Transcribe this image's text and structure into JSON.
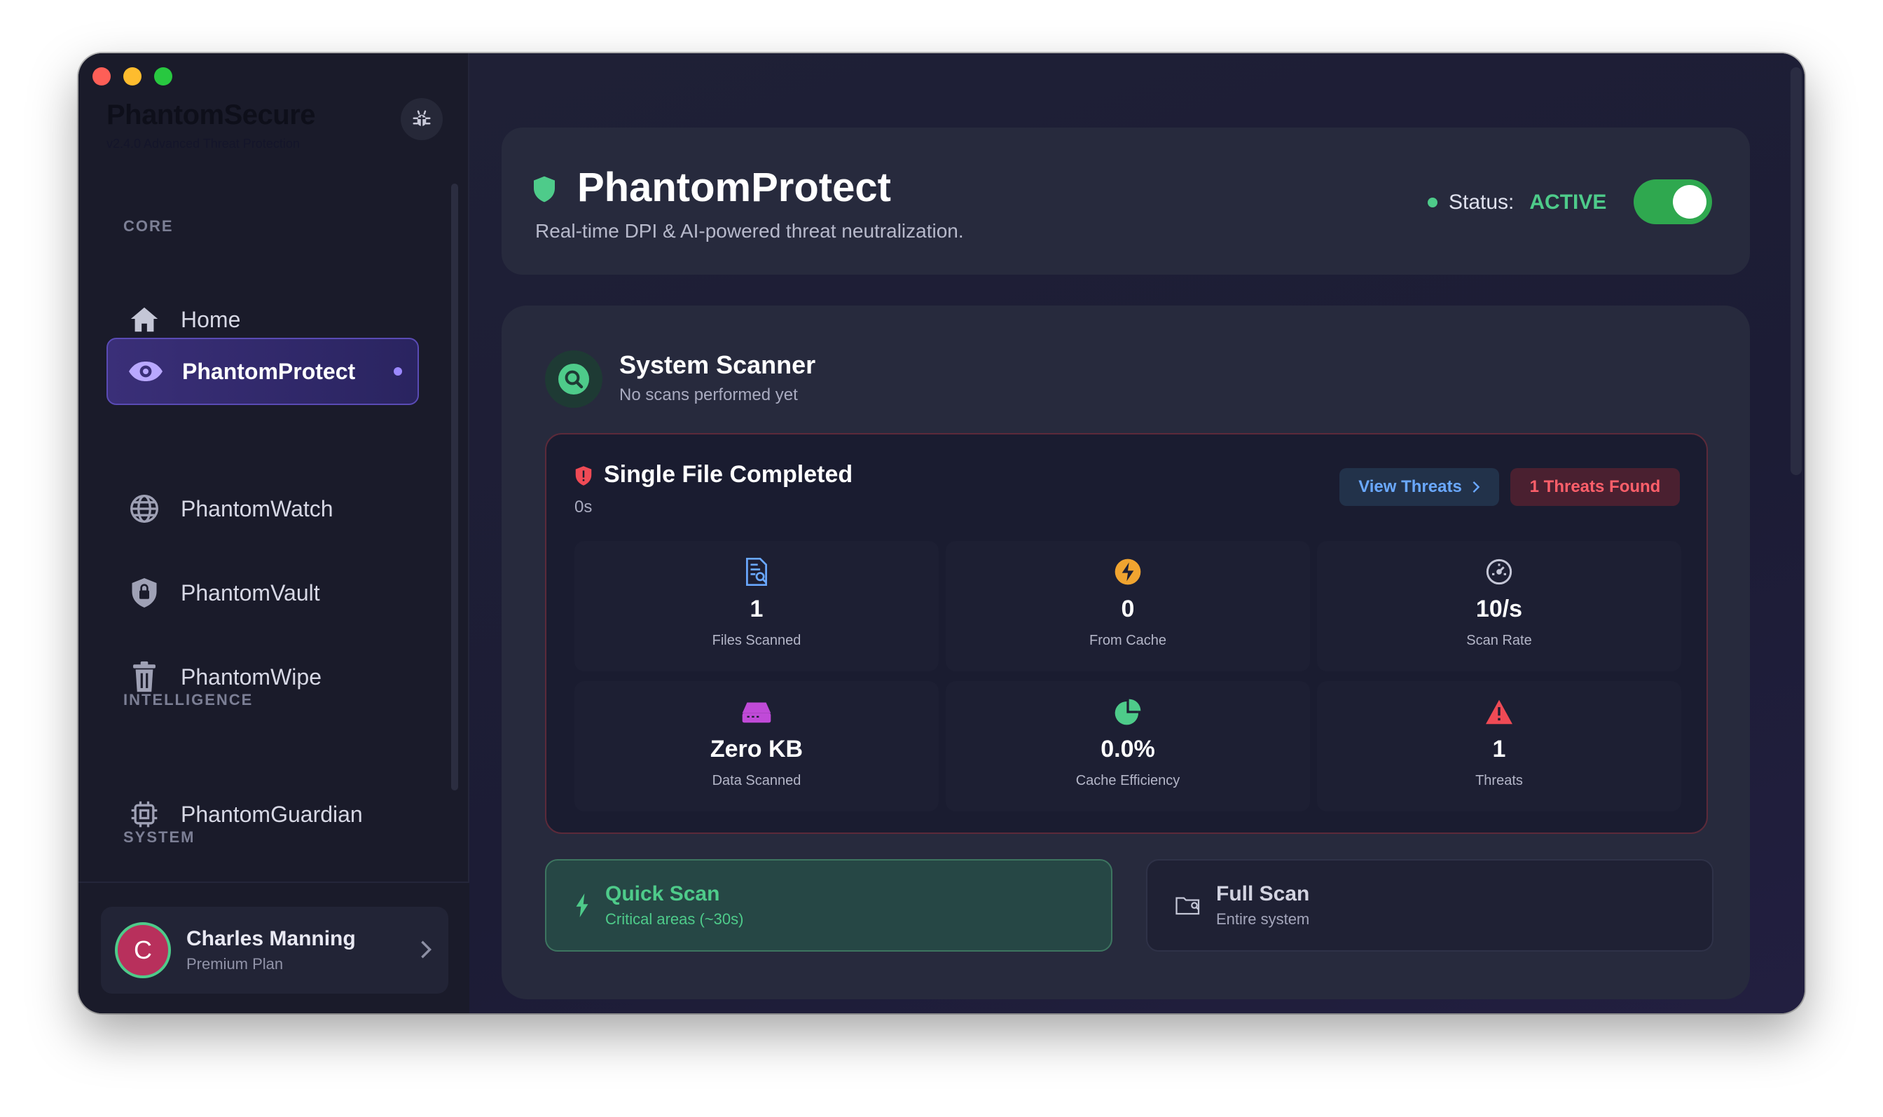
{
  "window": {
    "controls": [
      "close",
      "minimize",
      "zoom"
    ]
  },
  "sidebar": {
    "brand_title": "PhantomSecure",
    "brand_subtitle": "v2.4.0 Advanced Threat Protection",
    "sections": {
      "core": "CORE",
      "intelligence": "INTELLIGENCE",
      "system": "SYSTEM"
    },
    "items": [
      {
        "label": "Home",
        "icon": "home-icon"
      },
      {
        "label": "PhantomProtect",
        "icon": "eye-icon",
        "active": true
      },
      {
        "label": "PhantomWatch",
        "icon": "globe-icon"
      },
      {
        "label": "PhantomVault",
        "icon": "lock-shield-icon"
      },
      {
        "label": "PhantomWipe",
        "icon": "trash-icon"
      },
      {
        "label": "PhantomGuardian",
        "icon": "chip-icon"
      }
    ],
    "user": {
      "initial": "C",
      "name": "Charles Manning",
      "plan": "Premium Plan"
    }
  },
  "header": {
    "title": "PhantomProtect",
    "description": "Real-time DPI & AI-powered threat neutralization.",
    "status_label": "Status:",
    "status_value": "ACTIVE",
    "toggle_on": true
  },
  "scanner": {
    "title": "System Scanner",
    "subtitle": "No scans performed yet",
    "result": {
      "title": "Single File Completed",
      "duration": "0s",
      "view_threats_label": "View Threats",
      "threats_found_label": "1 Threats Found",
      "stats": [
        {
          "value": "1",
          "label": "Files Scanned",
          "icon": "document-search-icon"
        },
        {
          "value": "0",
          "label": "From Cache",
          "icon": "bolt-icon"
        },
        {
          "value": "10/s",
          "label": "Scan Rate",
          "icon": "gauge-icon"
        },
        {
          "value": "Zero KB",
          "label": "Data Scanned",
          "icon": "drive-icon"
        },
        {
          "value": "0.0%",
          "label": "Cache Efficiency",
          "icon": "pie-chart-icon"
        },
        {
          "value": "1",
          "label": "Threats",
          "icon": "warning-icon"
        }
      ]
    },
    "quick_scan": {
      "title": "Quick Scan",
      "subtitle": "Critical areas (~30s)"
    },
    "full_scan": {
      "title": "Full Scan",
      "subtitle": "Entire system"
    }
  },
  "colors": {
    "accent_green": "#4ecb8a",
    "accent_purple": "#5a4bb5",
    "danger": "#ff5f6a",
    "link_blue": "#6aa8ff"
  }
}
